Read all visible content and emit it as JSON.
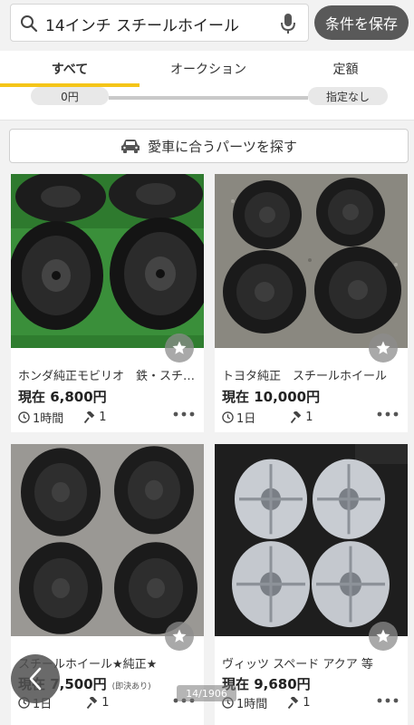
{
  "search": {
    "query": "14インチ スチールホイール",
    "save_label": "条件を保存"
  },
  "tabs": [
    "すべて",
    "オークション",
    "定額"
  ],
  "price_filter": {
    "min": "0円",
    "max": "指定なし"
  },
  "parts_button": {
    "label": "愛車に合うパーツを探す"
  },
  "items": [
    {
      "title": "ホンダ純正モビリオ　鉄・スチールホイール",
      "price": "現在 6,800円",
      "time": "1時間",
      "bids": "1"
    },
    {
      "title": "トヨタ純正　スチールホイール",
      "price": "現在 10,000円",
      "time": "1日",
      "bids": "1"
    },
    {
      "title": "スチールホイール★純正★",
      "price": "現在 7,500円",
      "buy_now": "(即決あり)",
      "time": "1日",
      "bids": "1"
    },
    {
      "title": "ヴィッツ スペード アクア 等",
      "price": "現在 9,680円",
      "time": "1時間",
      "bids": "1"
    }
  ],
  "page_indicator": "14/1906",
  "colors": {
    "accent": "#f5c518",
    "save_button_bg": "#595959"
  }
}
